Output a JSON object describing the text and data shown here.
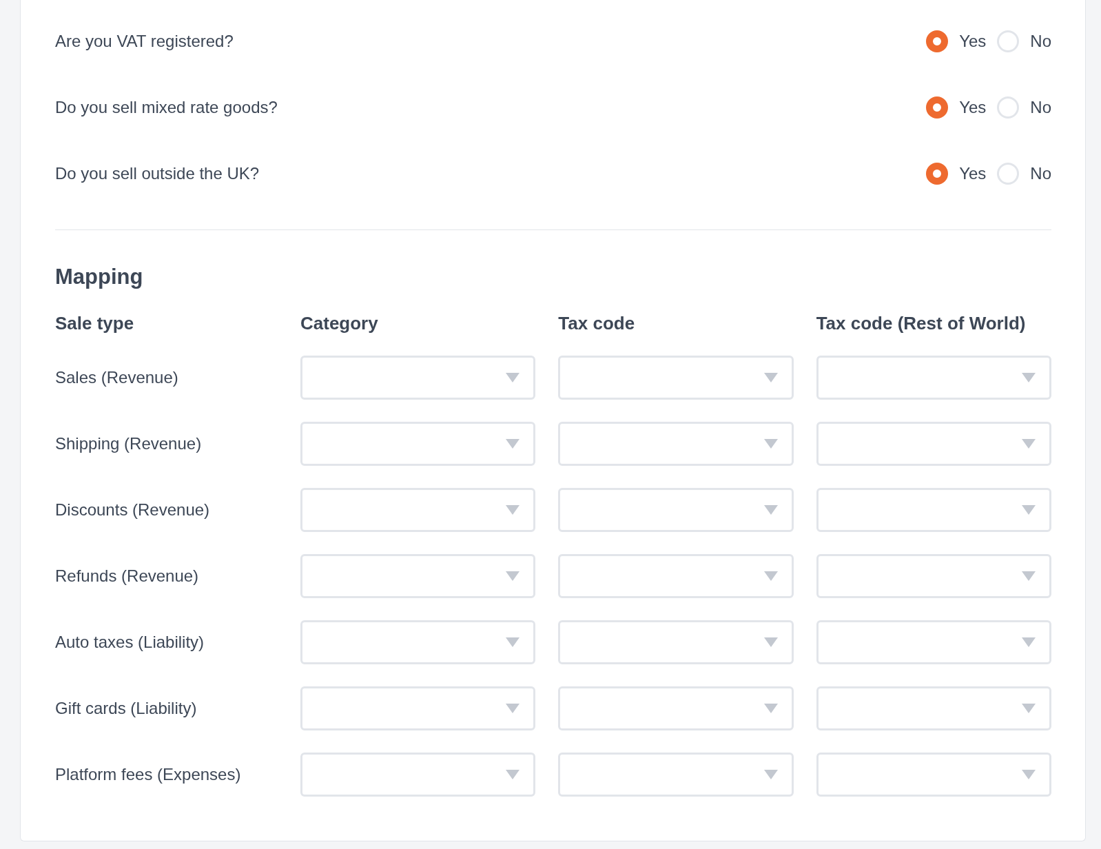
{
  "questions": [
    {
      "label": "Are you VAT registered?",
      "options": [
        {
          "label": "Yes",
          "selected": true
        },
        {
          "label": "No",
          "selected": false
        }
      ]
    },
    {
      "label": "Do you sell mixed rate goods?",
      "options": [
        {
          "label": "Yes",
          "selected": true
        },
        {
          "label": "No",
          "selected": false
        }
      ]
    },
    {
      "label": "Do you sell outside the UK?",
      "options": [
        {
          "label": "Yes",
          "selected": true
        },
        {
          "label": "No",
          "selected": false
        }
      ]
    }
  ],
  "mapping": {
    "title": "Mapping",
    "columns": [
      "Sale type",
      "Category",
      "Tax code",
      "Tax code (Rest of World)"
    ],
    "rows": [
      "Sales (Revenue)",
      "Shipping (Revenue)",
      "Discounts (Revenue)",
      "Refunds (Revenue)",
      "Auto taxes (Liability)",
      "Gift cards (Liability)",
      "Platform fees (Expenses)"
    ]
  }
}
